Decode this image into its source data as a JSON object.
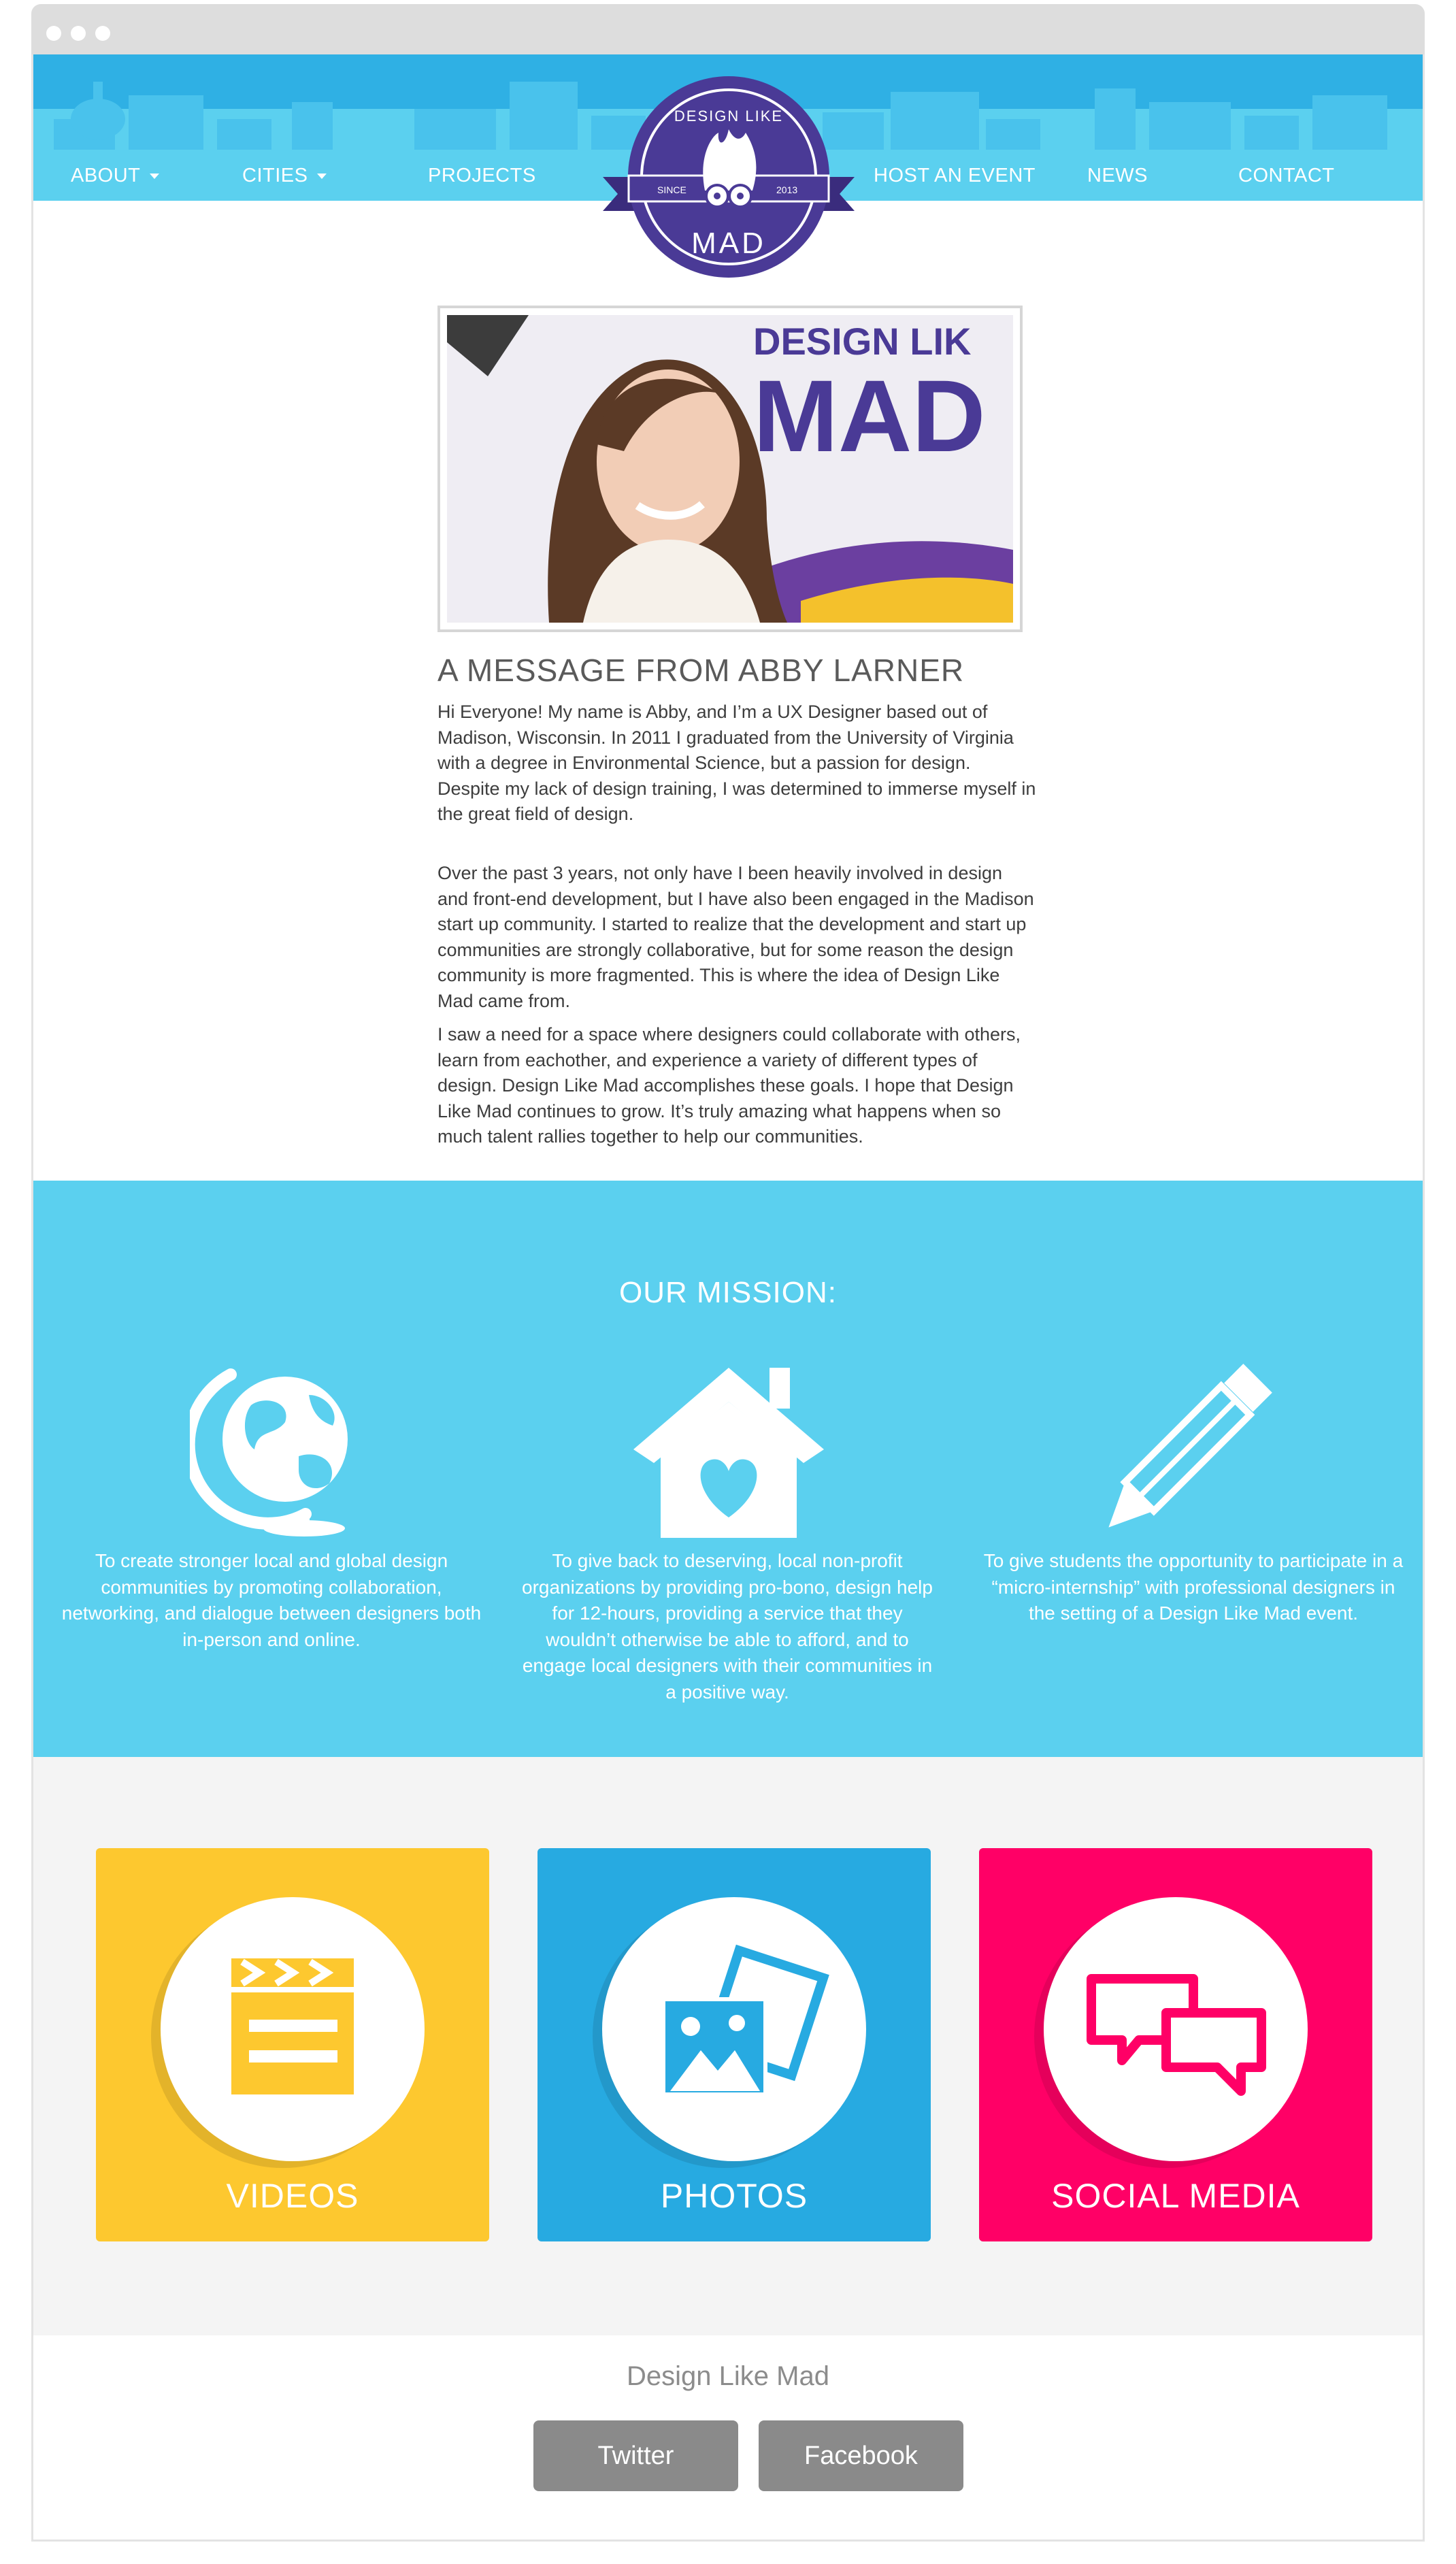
{
  "nav": {
    "about": "ABOUT",
    "cities": "CITIES",
    "projects": "PROJECTS",
    "host": "HOST AN EVENT",
    "news": "NEWS",
    "contact": "CONTACT"
  },
  "logo": {
    "top_text": "DESIGN LIKE",
    "bottom_text": "MAD",
    "since": "SINCE",
    "year": "2013"
  },
  "photo": {
    "sign_text_1": "DESIGN LIK",
    "sign_text_2": "MAD"
  },
  "message": {
    "title": "A MESSAGE FROM ABBY LARNER",
    "paragraphs": [
      "Hi Everyone! My name is Abby, and I’m a UX Designer based out of Madison, Wisconsin. In 2011 I graduated from the University of Virginia with a degree in Environmental Science, but a passion for design. Despite my lack of design training, I was determined to immerse myself in the great field of design.",
      "Over the past 3 years, not only have I been heavily involved in design and front-end development, but I have also been engaged in the Madison start up community. I started to realize that the development and start up communities are strongly collaborative, but for some reason the design community is more fragmented. This is where the idea of Design Like Mad came from.",
      "I saw a need for a space where designers could collaborate with others, learn from eachother, and experience a variety of different types of design. Design Like Mad accomplishes these goals. I hope that Design Like Mad continues to grow. It’s truly amazing what happens when so much talent rallies together to help our communities."
    ]
  },
  "mission": {
    "title": "OUR MISSION:",
    "items": [
      {
        "icon": "globe-icon",
        "text": "To create stronger local and global design communities by promoting collaboration, networking, and dialogue between designers both in-person and online."
      },
      {
        "icon": "heart-house-icon",
        "text": "To give back to deserving, local non-profit organizations by providing pro-bono, design help for 12-hours, providing a service that they wouldn’t otherwise be able to afford, and to engage local designers with their communities in a positive way."
      },
      {
        "icon": "pencil-icon",
        "text": "To give students the opportunity to participate in a “micro-internship” with professional designers in the setting of a Design Like Mad event."
      }
    ]
  },
  "tiles": [
    {
      "label": "VIDEOS",
      "color": "#fdc82f",
      "icon": "clapperboard-icon"
    },
    {
      "label": "PHOTOS",
      "color": "#27aae1",
      "icon": "photos-icon"
    },
    {
      "label": "SOCIAL MEDIA",
      "color": "#ff0066",
      "icon": "chat-bubbles-icon"
    }
  ],
  "footer": {
    "title": "Design Like Mad",
    "twitter": "Twitter",
    "facebook": "Facebook"
  },
  "colors": {
    "sky_blue": "#5bd0ef",
    "logo_purple": "#4a3a96",
    "button_gray": "#8a8a8a"
  }
}
